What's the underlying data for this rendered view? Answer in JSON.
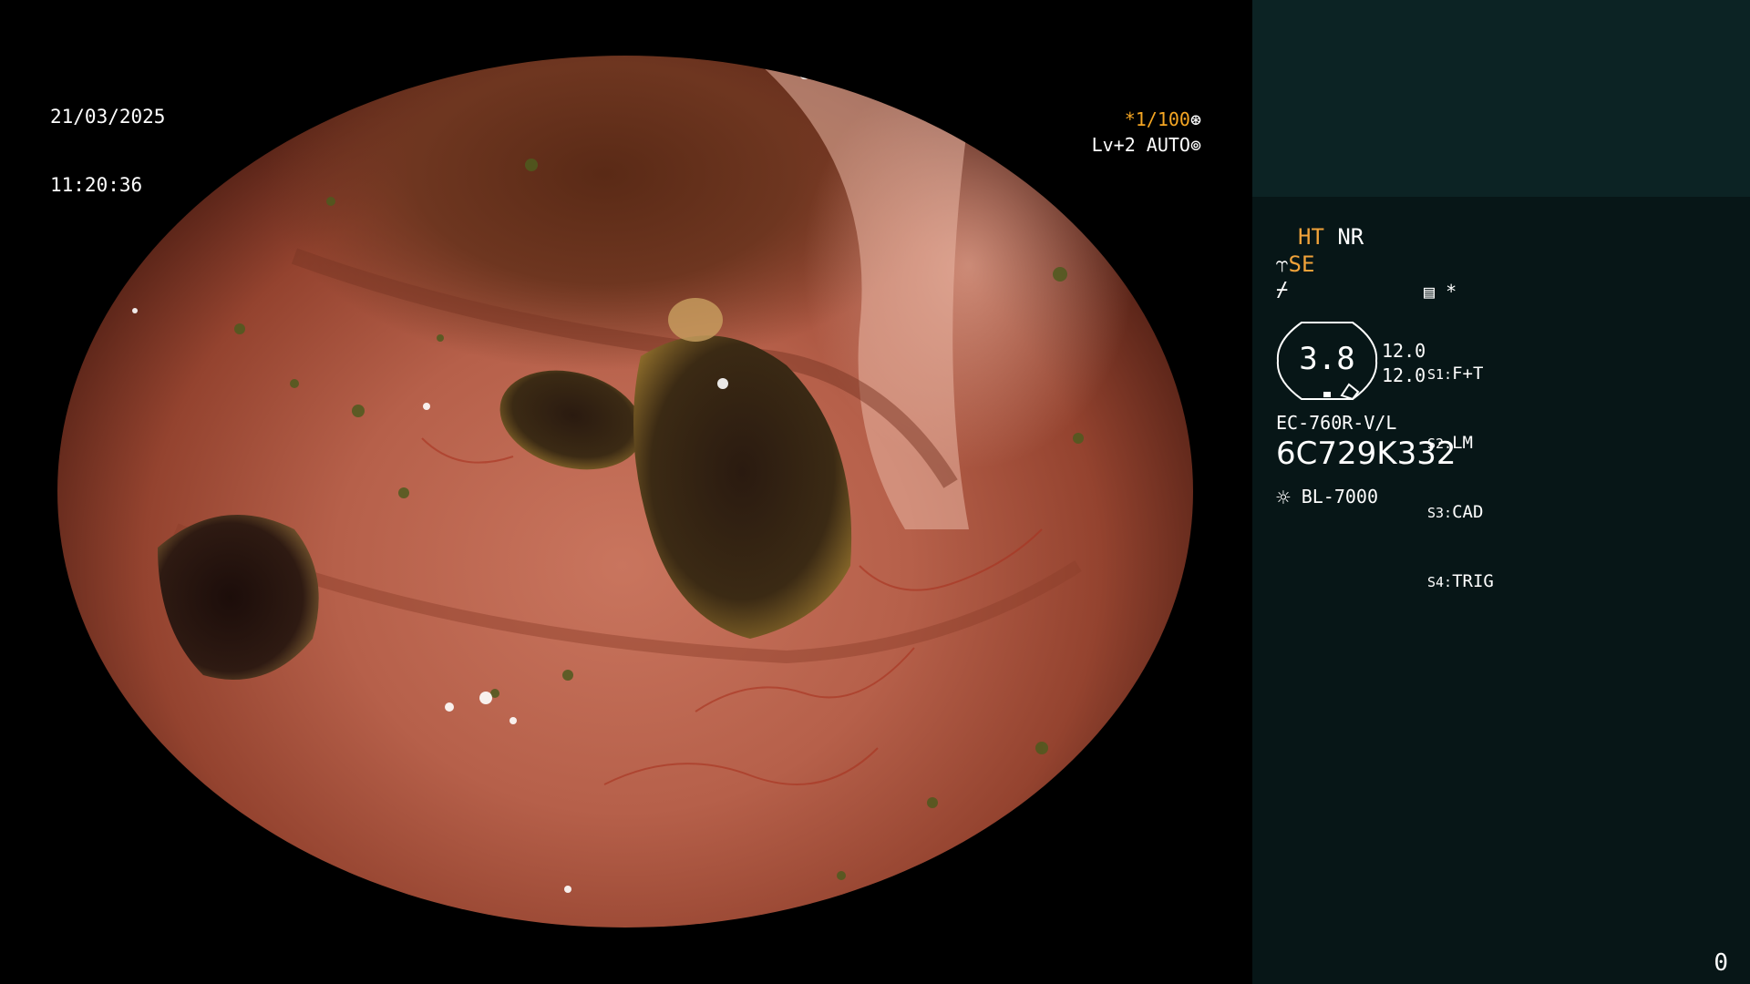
{
  "overlay": {
    "date": "21/03/2025",
    "time": "11:20:36",
    "shutter": "*1/100",
    "level": "Lv+2 AUTO"
  },
  "panel": {
    "ht": "HT",
    "nr": "NR",
    "se": "SE",
    "gauge_value": "3.8",
    "value_1": "12.0",
    "value_2": "12.0",
    "slots": [
      {
        "key": "S1:",
        "value": "F+T"
      },
      {
        "key": "S2:",
        "value": "LM"
      },
      {
        "key": "S3:",
        "value": "CAD"
      },
      {
        "key": "S4:",
        "value": "TRIG"
      }
    ],
    "memo_star": "*",
    "model": "EC-760R-V/L",
    "serial": "6C729K332",
    "light_source": "BL-7000",
    "counter": "0"
  },
  "colors": {
    "accent_orange": "#f0a23a",
    "panel_bg": "#071617",
    "thumb_bg": "#0c2324"
  },
  "icons": [
    "aperture-icon",
    "auto-iris-icon",
    "scope-icon",
    "freeze-icon",
    "memo-icon",
    "light-source-icon"
  ]
}
